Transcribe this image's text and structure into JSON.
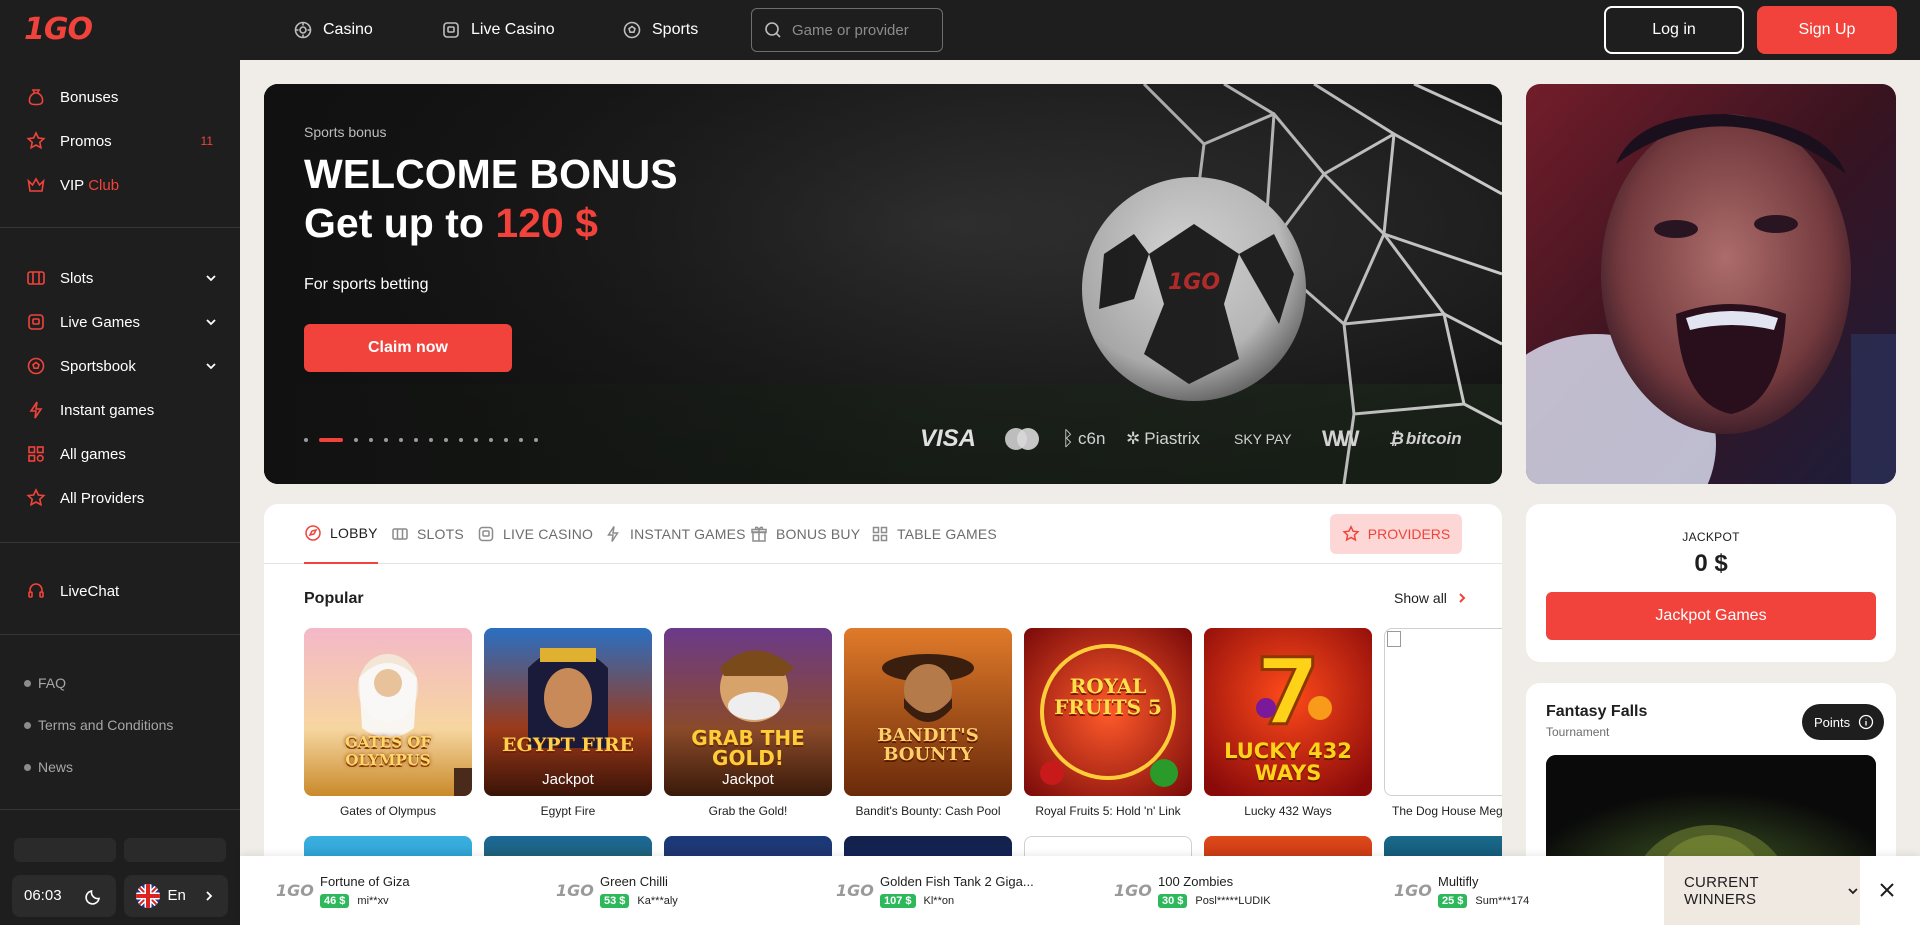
{
  "brand": {
    "logo": "1GO",
    "accent": "#f1433b"
  },
  "header": {
    "nav": [
      {
        "label": "Casino",
        "icon": "casino-chip-icon"
      },
      {
        "label": "Live Casino",
        "icon": "live-casino-icon"
      },
      {
        "label": "Sports",
        "icon": "soccer-ball-icon"
      }
    ],
    "search_placeholder": "Game or provider",
    "login_label": "Log in",
    "signup_label": "Sign Up"
  },
  "sidebar": {
    "top": [
      {
        "label": "Bonuses",
        "icon": "money-bag-icon"
      },
      {
        "label": "Promos",
        "icon": "star-icon",
        "count": "11"
      },
      {
        "label": "VIP",
        "label_suffix": "Club",
        "icon": "crown-icon"
      }
    ],
    "categories": [
      {
        "label": "Slots",
        "icon": "slot-machine-icon"
      },
      {
        "label": "Live Games",
        "icon": "live-games-icon"
      },
      {
        "label": "Sportsbook",
        "icon": "soccer-ball-icon"
      },
      {
        "label": "Instant games",
        "icon": "lightning-icon"
      },
      {
        "label": "All games",
        "icon": "grid-icon"
      },
      {
        "label": "All Providers",
        "icon": "star-icon"
      }
    ],
    "support": {
      "label": "LiveChat",
      "icon": "headset-icon"
    },
    "footer_links": [
      "FAQ",
      "Terms and Conditions",
      "News"
    ],
    "time": "06:03",
    "language": "En"
  },
  "hero": {
    "kicker": "Sports bonus",
    "title_line1": "WELCOME BONUS",
    "title_line2_prefix": "Get up to",
    "title_line2_amount": "120 $",
    "subtitle": "For sports betting",
    "cta": "Claim now",
    "slides_total": 15,
    "active_slide": 2,
    "payments": [
      "VISA",
      "mastercard",
      "c6n",
      "Piastrix",
      "SKY PAY",
      "W",
      "bitcoin"
    ]
  },
  "games": {
    "tabs": [
      {
        "label": "LOBBY",
        "icon": "lobby-icon"
      },
      {
        "label": "SLOTS",
        "icon": "slot-machine-icon"
      },
      {
        "label": "LIVE CASINO",
        "icon": "live-casino-icon"
      },
      {
        "label": "INSTANT GAMES",
        "icon": "lightning-icon"
      },
      {
        "label": "BONUS BUY",
        "icon": "gift-icon"
      },
      {
        "label": "TABLE GAMES",
        "icon": "grid-icon"
      }
    ],
    "providers_label": "PROVIDERS",
    "section_title": "Popular",
    "show_all": "Show all",
    "popular": [
      {
        "name": "Gates of Olympus",
        "art": "GATES OF OLYMPUS",
        "badge": ""
      },
      {
        "name": "Egypt Fire",
        "art": "EGYPT FIRE",
        "badge": "Jackpot"
      },
      {
        "name": "Grab the Gold!",
        "art": "GRAB THE GOLD!",
        "badge": "Jackpot"
      },
      {
        "name": "Bandit's Bounty: Cash Pool",
        "art": "BANDIT'S BOUNTY",
        "badge": ""
      },
      {
        "name": "Royal Fruits 5: Hold 'n' Link",
        "art": "ROYAL FRUITS 5",
        "badge": ""
      },
      {
        "name": "Lucky 432 Ways",
        "art": "LUCKY 432 WAYS",
        "badge": ""
      },
      {
        "name": "The Dog House Meg",
        "art": "",
        "badge": ""
      }
    ]
  },
  "jackpot": {
    "label": "JACKPOT",
    "amount": "0 $",
    "button": "Jackpot Games"
  },
  "tournament": {
    "title": "Fantasy Falls",
    "subtitle": "Tournament",
    "points_label": "Points"
  },
  "winners": {
    "items": [
      {
        "game": "Fortune of Giza",
        "amount": "46 $",
        "user": "mi**xv"
      },
      {
        "game": "Green Chilli",
        "amount": "53 $",
        "user": "Ka***aly"
      },
      {
        "game": "Golden Fish Tank 2 Giga...",
        "amount": "107 $",
        "user": "Kl**on"
      },
      {
        "game": "100 Zombies",
        "amount": "30 $",
        "user": "Posl*****LUDIK"
      },
      {
        "game": "Multifly",
        "amount": "25 $",
        "user": "Sum***174"
      }
    ],
    "label": "CURRENT WINNERS",
    "win_color": "#2eb85c"
  }
}
